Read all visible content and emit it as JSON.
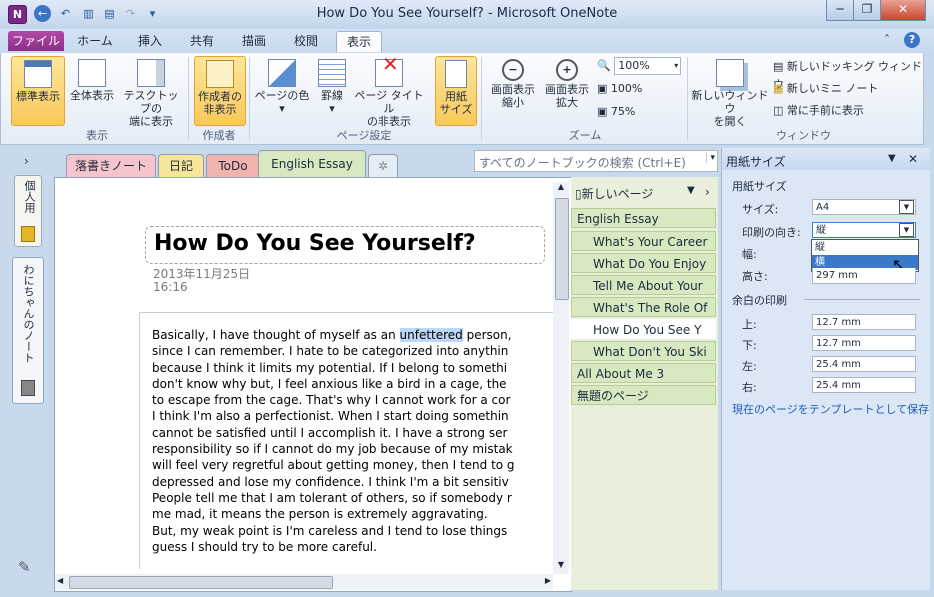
{
  "window": {
    "title": "How Do You See Yourself? - Microsoft OneNote",
    "app_icon": "N"
  },
  "ribbon_tabs": [
    "ファイル",
    "ホーム",
    "挿入",
    "共有",
    "描画",
    "校閲",
    "表示"
  ],
  "ribbon": {
    "group_view": {
      "label": "表示",
      "buttons": [
        "標準表示",
        "全体表示",
        "テスクトップの\n端に表示"
      ]
    },
    "group_author": {
      "label": "作成者",
      "buttons": [
        "作成者の\n非表示"
      ]
    },
    "group_page": {
      "label": "ページ設定",
      "buttons": [
        "ページの色",
        "罫線",
        "ページ タイトル\nの非表示",
        "用紙\nサイズ"
      ]
    },
    "group_zoom": {
      "label": "ズーム",
      "buttons": [
        "画面表示\n縮小",
        "画面表示\n拡大"
      ],
      "zoom_value": "100%",
      "zoom_100": "100%",
      "zoom_75": "75%"
    },
    "group_window": {
      "label": "ウィンドウ",
      "buttons": [
        "新しいウィンドウ\nを開く"
      ],
      "small": [
        "新しいドッキング ウィンドウ",
        "新しいミニ ノート",
        "常に手前に表示"
      ]
    }
  },
  "section_tabs": [
    "落書きノート",
    "日記",
    "ToDo",
    "English Essay"
  ],
  "search": {
    "placeholder": "すべてのノートブックの検索 (Ctrl+E)"
  },
  "notebook": {
    "name": "わにちゃんのノート",
    "side_label": "個人用"
  },
  "page": {
    "title": "How Do You See Yourself?",
    "date": "2013年11月25日",
    "time": "16:16",
    "lines": [
      [
        "Basically, I have thought of myself as an ",
        "unfettered",
        " person,"
      ],
      [
        "since I can remember.  I hate to be categorized into anythin"
      ],
      [
        "because I think it limits my potential. If I belong to somethi"
      ],
      [
        "don't know why but, I feel anxious like a bird in a cage, the"
      ],
      [
        "to escape from the cage. That's why I cannot work for a cor"
      ],
      [
        "I think I'm also a perfectionist. When I start doing somethin"
      ],
      [
        "cannot be satisfied until I accomplish it. I have a strong ser"
      ],
      [
        "responsibility so if I cannot do my job because of my mistak"
      ],
      [
        "will feel very regretful about getting money, then I tend to g"
      ],
      [
        "depressed and lose my confidence. I think I'm a bit sensitiv"
      ],
      [
        "People tell me that I am tolerant of others, so if somebody r"
      ],
      [
        "me mad, it means the person is extremely aggravating."
      ],
      [
        "But, my weak point is I'm careless and I tend to lose things"
      ],
      [
        "guess I should try to be more careful."
      ]
    ]
  },
  "pages_panel": {
    "new_page": "新しいページ",
    "pages": [
      "English Essay",
      "What's Your Career",
      "What Do You Enjoy",
      "Tell Me About Your",
      "What's The Role Of",
      "How Do You See Y",
      "What Don't You Ski",
      "All About Me 3",
      "無題のページ"
    ]
  },
  "paper_pane": {
    "title": "用紙サイズ",
    "section_size": "用紙サイズ",
    "size_label": "サイズ:",
    "size_value": "A4",
    "orientation_label": "印刷の向き:",
    "orientation_value": "縦",
    "orientation_options": [
      "縦",
      "横"
    ],
    "width_label": "幅:",
    "height_label": "高さ:",
    "height_value": "297 mm",
    "section_margin": "余白の印刷",
    "margins": [
      {
        "label": "上:",
        "value": "12.7 mm"
      },
      {
        "label": "下:",
        "value": "12.7 mm"
      },
      {
        "label": "左:",
        "value": "25.4 mm"
      },
      {
        "label": "右:",
        "value": "25.4 mm"
      }
    ],
    "template_link": "現在のページをテンプレートとして保存"
  },
  "colors": {
    "accent": "#2b5797",
    "selection": "#bcd8f5",
    "file_tab": "#9b3a94",
    "highlight": "#f8c85a"
  }
}
